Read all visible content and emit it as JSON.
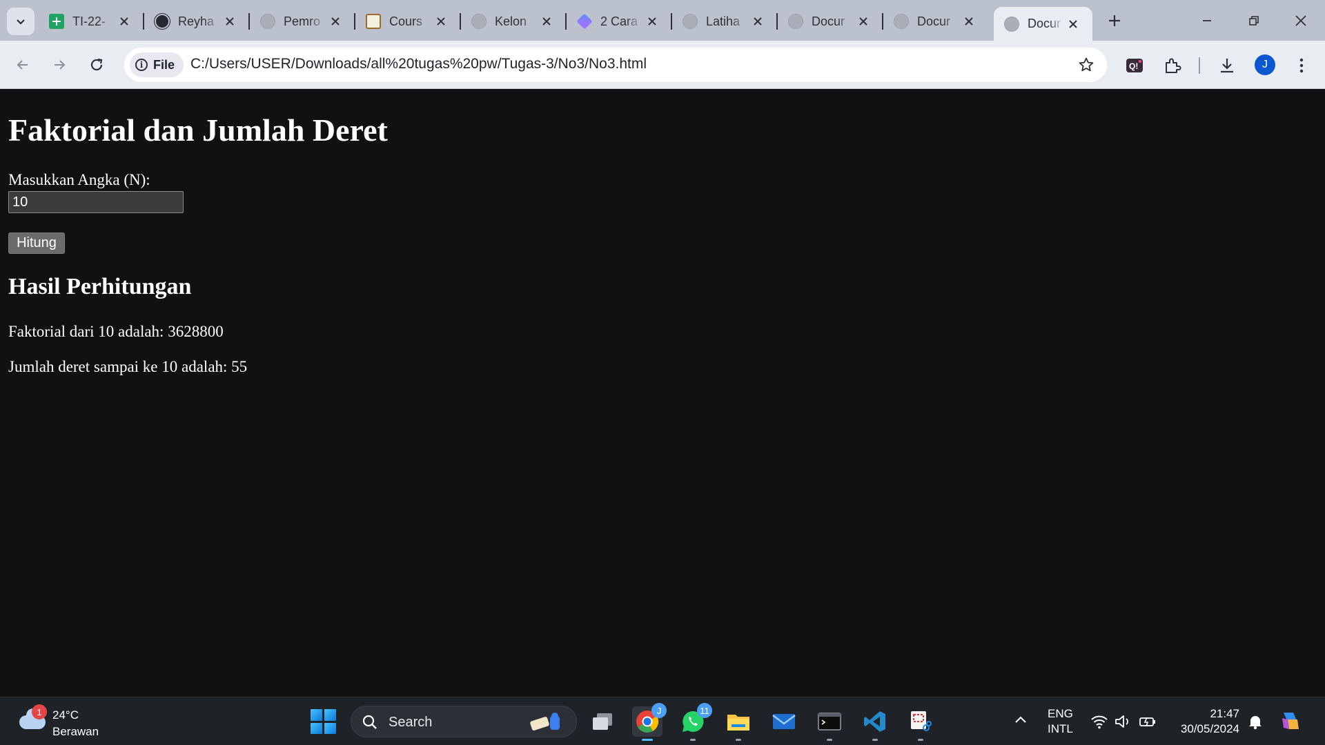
{
  "browser": {
    "tabs": [
      {
        "label": "TI-22-",
        "icon": "sheets-icon"
      },
      {
        "label": "Reyha",
        "icon": "github-icon"
      },
      {
        "label": "Pemro",
        "icon": "globe-icon"
      },
      {
        "label": "Cours",
        "icon": "course-icon"
      },
      {
        "label": "Kelon",
        "icon": "globe-icon"
      },
      {
        "label": "2 Cara",
        "icon": "cube-icon"
      },
      {
        "label": "Latiha",
        "icon": "globe-icon"
      },
      {
        "label": "Docur",
        "icon": "globe-icon"
      },
      {
        "label": "Docur",
        "icon": "globe-icon"
      },
      {
        "label": "Docur",
        "icon": "globe-icon",
        "active": true
      }
    ],
    "address_bar": {
      "scheme_chip": "File",
      "url": "C:/Users/USER/Downloads/all%20tugas%20pw/Tugas-3/No3/No3.html"
    },
    "profile_initial": "J",
    "colors": {
      "tabstrip": "#bcc2cd",
      "toolbar": "#e9ecf0",
      "page_bg": "#111111",
      "avatar": "#0b57d0"
    }
  },
  "page": {
    "title": "Faktorial dan Jumlah Deret",
    "input_label": "Masukkan Angka (N):",
    "input_value": "10",
    "button_label": "Hitung",
    "results_heading": "Hasil Perhitungan",
    "factorial_result": "Faktorial dari 10 adalah: 3628800",
    "series_result": "Jumlah deret sampai ke 10 adalah: 55"
  },
  "taskbar": {
    "weather": {
      "temperature": "24°C",
      "condition": "Berawan",
      "badge": "1"
    },
    "search_placeholder": "Search",
    "apps": [
      {
        "name": "task-view-icon"
      },
      {
        "name": "chrome-icon",
        "badge": "J",
        "active": true
      },
      {
        "name": "whatsapp-icon",
        "badge": "11"
      },
      {
        "name": "file-explorer-icon"
      },
      {
        "name": "mail-icon"
      },
      {
        "name": "terminal-icon"
      },
      {
        "name": "vscode-icon"
      },
      {
        "name": "snipping-tool-icon"
      }
    ],
    "language": {
      "line1": "ENG",
      "line2": "INTL"
    },
    "clock": {
      "time": "21:47",
      "date": "30/05/2024"
    }
  }
}
